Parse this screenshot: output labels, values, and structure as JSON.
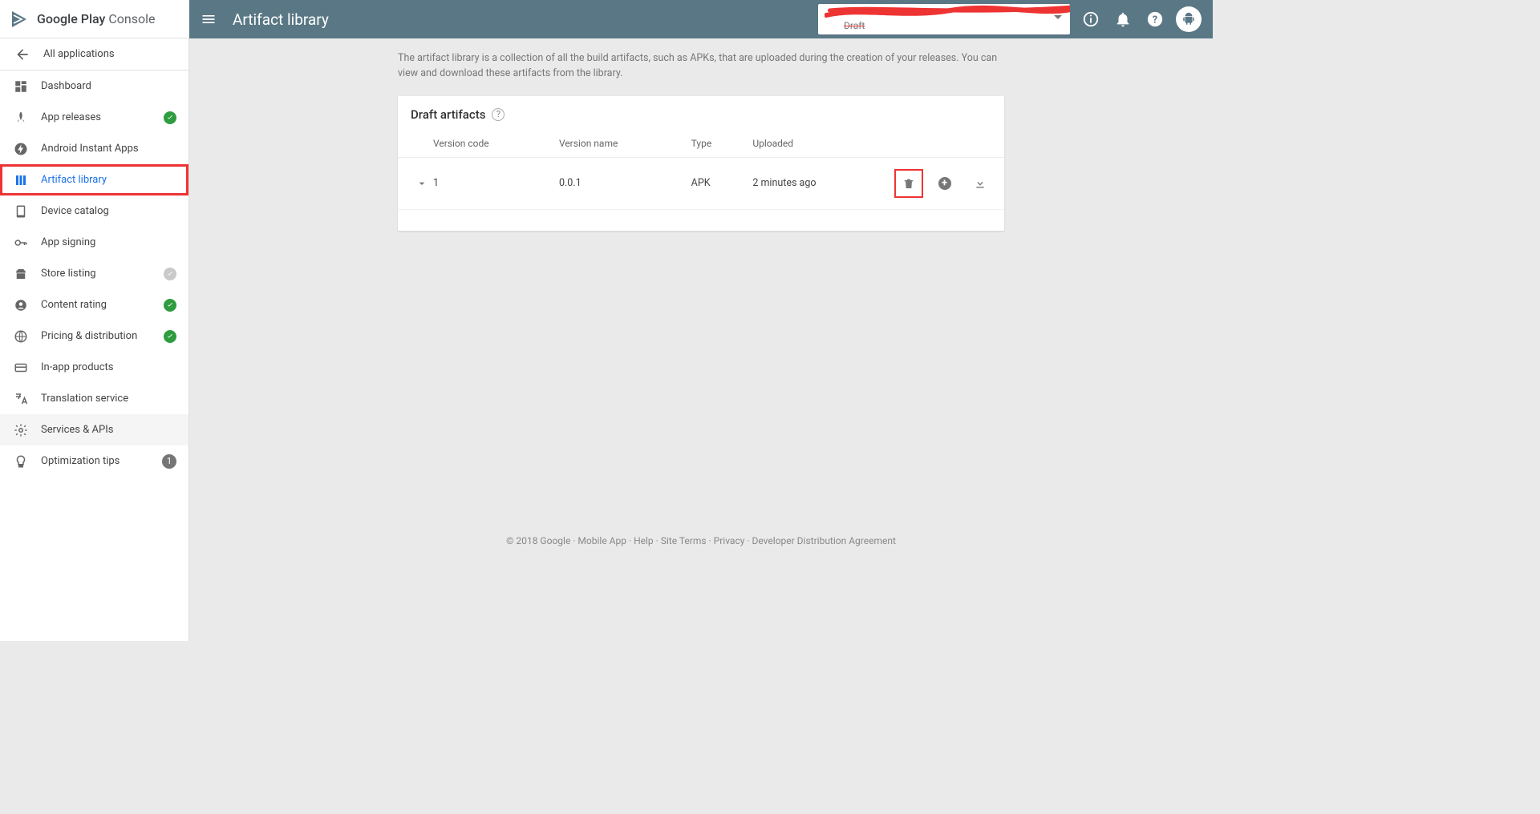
{
  "header": {
    "logo": "Google Play Console",
    "title": "Artifact library",
    "selector_subtext": "Draft"
  },
  "sidebar": {
    "back": "All applications",
    "items": [
      {
        "label": "Dashboard"
      },
      {
        "label": "App releases"
      },
      {
        "label": "Android Instant Apps"
      },
      {
        "label": "Artifact library"
      },
      {
        "label": "Device catalog"
      },
      {
        "label": "App signing"
      },
      {
        "label": "Store listing"
      },
      {
        "label": "Content rating"
      },
      {
        "label": "Pricing & distribution"
      },
      {
        "label": "In-app products"
      },
      {
        "label": "Translation service"
      },
      {
        "label": "Services & APIs"
      },
      {
        "label": "Optimization tips"
      }
    ],
    "tips_count": "1"
  },
  "main": {
    "description": "The artifact library is a collection of all the build artifacts, such as APKs, that are uploaded during the creation of your releases. You can view and download these artifacts from the library.",
    "card_title": "Draft artifacts",
    "columns": {
      "c1": "Version code",
      "c2": "Version name",
      "c3": "Type",
      "c4": "Uploaded"
    },
    "rows": [
      {
        "code": "1",
        "name": "0.0.1",
        "type": "APK",
        "uploaded": "2 minutes ago"
      }
    ]
  },
  "footer": {
    "copyright": "© 2018 Google",
    "links": [
      "Mobile App",
      "Help",
      "Site Terms",
      "Privacy",
      "Developer Distribution Agreement"
    ]
  }
}
